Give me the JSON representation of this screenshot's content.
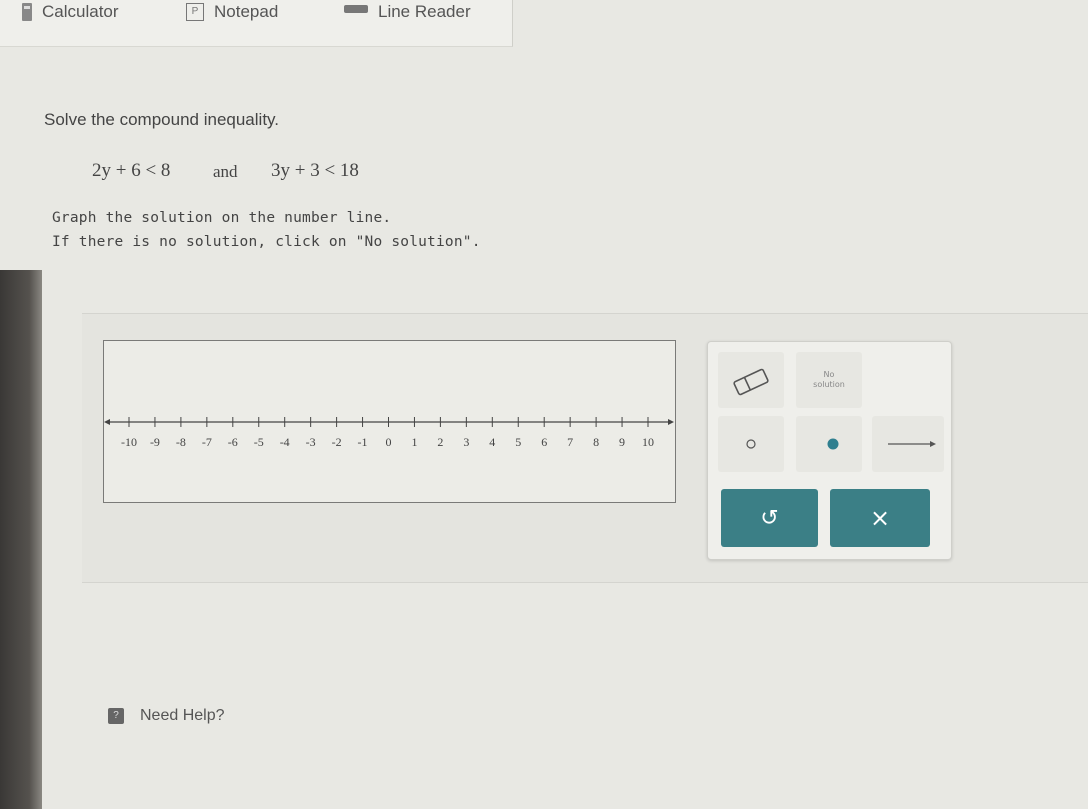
{
  "toolbar": {
    "calculator": "Calculator",
    "notepad": "Notepad",
    "notepad_icon_letter": "P",
    "line_reader": "Line Reader"
  },
  "problem": {
    "prompt": "Solve the compound inequality.",
    "inequality_1": "2y + 6 < 8",
    "connector": "and",
    "inequality_2": "3y + 3 < 18",
    "instruction_1": "Graph the solution on the number line.",
    "instruction_2": "If there is no solution, click on \"No solution\"."
  },
  "number_line": {
    "min": -10,
    "max": 10,
    "ticks": [
      "-10",
      "-9",
      "-8",
      "-7",
      "-6",
      "-5",
      "-4",
      "-3",
      "-2",
      "-1",
      "0",
      "1",
      "2",
      "3",
      "4",
      "5",
      "6",
      "7",
      "8",
      "9",
      "10"
    ]
  },
  "tools": {
    "no_solution_line1": "No",
    "no_solution_line2": "solution",
    "undo_symbol": "↺",
    "clear_symbol": "×",
    "accent_color": "#3b7f86"
  },
  "help": {
    "icon": "?",
    "label": "Need Help?"
  }
}
